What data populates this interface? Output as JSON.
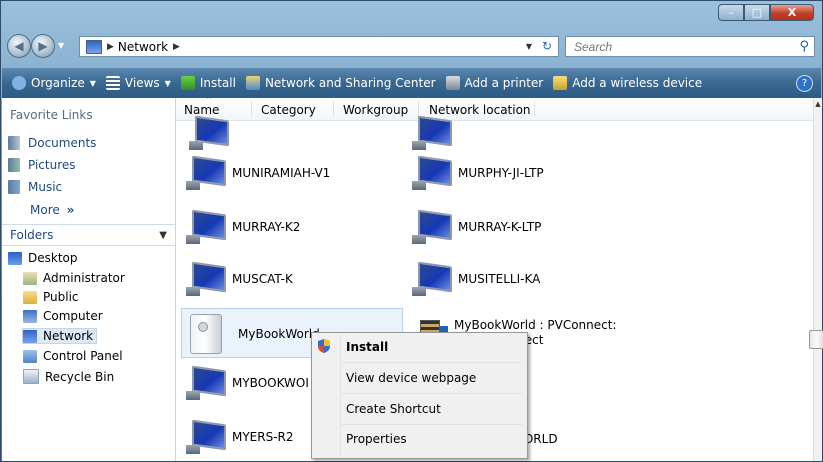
{
  "window": {
    "caption_buttons": {
      "minimize_icon": "minimize-icon",
      "maximize_icon": "maximize-icon",
      "close_icon": "close-icon"
    }
  },
  "address": {
    "crumbs": [
      "Network"
    ],
    "search_placeholder": "Search"
  },
  "toolbar": {
    "items": [
      {
        "label": "Organize",
        "has_dropdown": true,
        "icon": "organize-icon"
      },
      {
        "label": "Views",
        "has_dropdown": true,
        "icon": "views-icon"
      },
      {
        "label": "Install",
        "has_dropdown": false,
        "icon": "install-shield-icon"
      },
      {
        "label": "Network and Sharing Center",
        "has_dropdown": false,
        "icon": "network-center-icon"
      },
      {
        "label": "Add a printer",
        "has_dropdown": false,
        "icon": "printer-icon"
      },
      {
        "label": "Add a wireless device",
        "has_dropdown": false,
        "icon": "wireless-device-icon"
      }
    ]
  },
  "nav": {
    "favorites_title": "Favorite Links",
    "favorites": [
      "Documents",
      "Pictures",
      "Music"
    ],
    "more_label": "More",
    "folders_label": "Folders",
    "tree": [
      "Desktop",
      "Administrator",
      "Public",
      "Computer",
      "Network",
      "Control Panel",
      "Recycle Bin"
    ]
  },
  "columns": [
    "Name",
    "Category",
    "Workgroup",
    "Network location"
  ],
  "items": {
    "muniramiah": "MUNIRAMIAH-V1",
    "murphy": "MURPHY-JI-LTP",
    "murray_k2": "MURRAY-K2",
    "murray_k_ltp": "MURRAY-K-LTP",
    "muscat": "MUSCAT-K",
    "musitelli": "MUSITELLI-KA",
    "mybookworld": "MyBookWorld",
    "mybookworld_pv_line1": "MyBookWorld : PVConnect:",
    "mybookworld_pv_line2": "Media Connect",
    "mybookwol": "MYBOOKWOI",
    "myers": "MYERS-R2",
    "world_partial": "WORLD"
  },
  "context_menu": [
    "Install",
    "View device webpage",
    "Create Shortcut",
    "Properties"
  ],
  "colors": {
    "toolbar": "#386891",
    "link": "#1e4a80",
    "selection": "#eaf2fb"
  }
}
